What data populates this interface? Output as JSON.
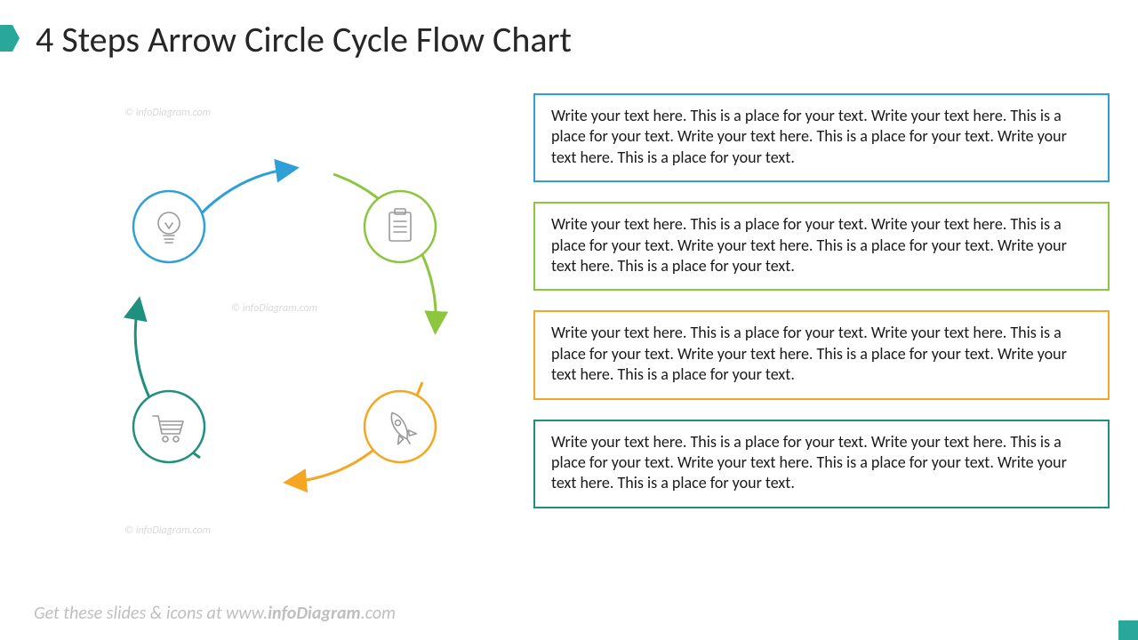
{
  "title": "4 Steps Arrow Circle Cycle Flow Chart",
  "footer_prefix": "Get these slides & icons at www.",
  "footer_bold": "infoDiagram",
  "footer_suffix": ".com",
  "watermark": "© infoDiagram.com",
  "placeholder": "Write your text here. This is a place for your text. Write your text here. This is a place for your text. Write your text here. This is a place for your text. Write your text here. This is a place for your text.",
  "colors": {
    "blue": "#2EA0D6",
    "green": "#8CC63F",
    "orange": "#F5A623",
    "teal": "#1F8F7E"
  },
  "steps": [
    {
      "id": "step1",
      "color": "blue",
      "icon": "lightbulb-icon"
    },
    {
      "id": "step2",
      "color": "green",
      "icon": "clipboard-icon"
    },
    {
      "id": "step3",
      "color": "orange",
      "icon": "rocket-icon"
    },
    {
      "id": "step4",
      "color": "teal",
      "icon": "cart-icon"
    }
  ],
  "boxes": [
    {
      "color": "blue"
    },
    {
      "color": "green"
    },
    {
      "color": "orange"
    },
    {
      "color": "teal"
    }
  ]
}
